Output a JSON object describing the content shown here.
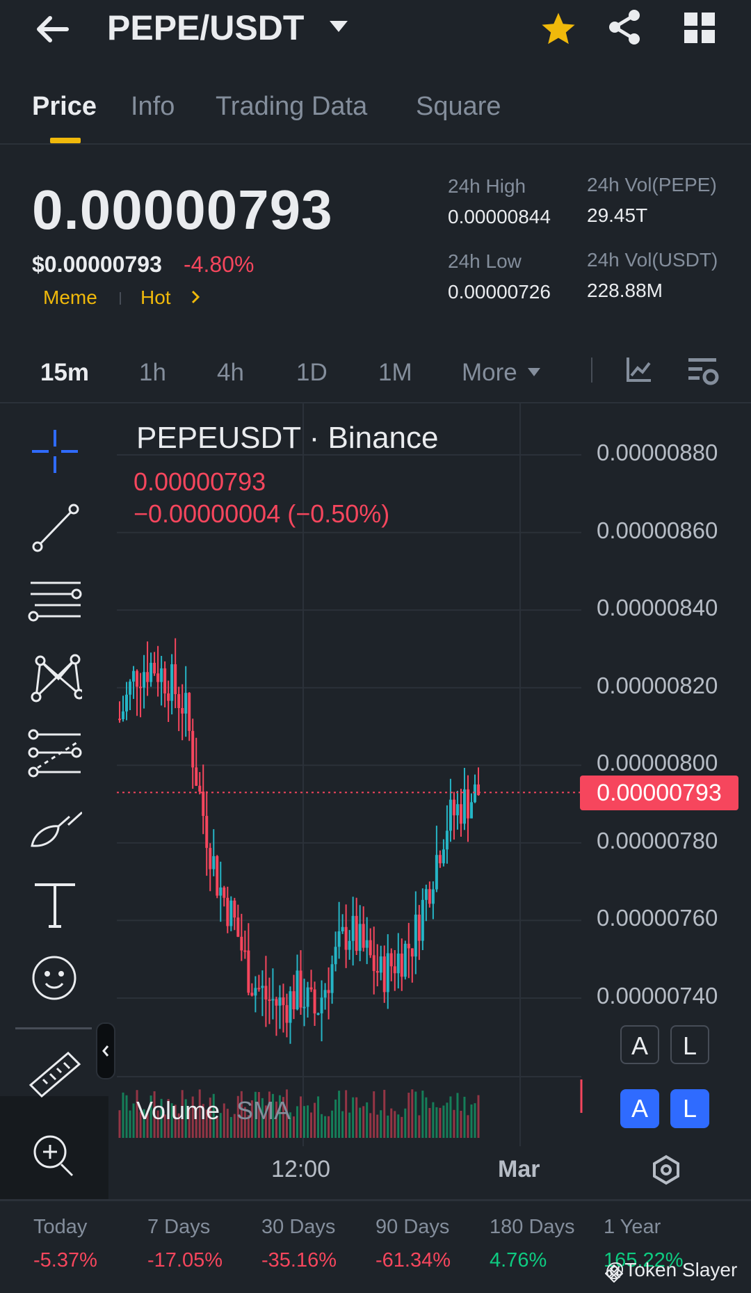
{
  "header": {
    "title": "PEPE/USDT",
    "back_icon": "arrow-left-icon",
    "favorite_icon": "star-icon",
    "share_icon": "share-icon",
    "menu_icon": "grid-icon"
  },
  "tabs": [
    {
      "label": "Price",
      "active": true
    },
    {
      "label": "Info",
      "active": false
    },
    {
      "label": "Trading Data",
      "active": false
    },
    {
      "label": "Square",
      "active": false
    }
  ],
  "price": {
    "last": "0.00000793",
    "usd": "$0.00000793",
    "change_pct": "-4.80%",
    "tags": [
      "Meme",
      "Hot"
    ]
  },
  "stats": {
    "high_label": "24h High",
    "high_value": "0.00000844",
    "low_label": "24h Low",
    "low_value": "0.00000726",
    "vol_base_label": "24h Vol(PEPE)",
    "vol_base_value": "29.45T",
    "vol_quote_label": "24h Vol(USDT)",
    "vol_quote_value": "228.88M"
  },
  "timeframes": {
    "items": [
      "15m",
      "1h",
      "4h",
      "1D",
      "1M",
      "More"
    ],
    "active": "15m"
  },
  "chart": {
    "symbol_title": "PEPEUSDT · Binance",
    "last_price": "0.00000793",
    "change_text": "−0.00000004 (−0.50%)",
    "price_badge": "0.00000793",
    "y_ticks": [
      "0.00000880",
      "0.00000860",
      "0.00000840",
      "0.00000820",
      "0.00000800",
      "0.00000780",
      "0.00000760",
      "0.00000740"
    ],
    "x_ticks": [
      "12:00",
      "Mar"
    ],
    "volume_label": "Volume",
    "volume_sma": "SMA",
    "auto_label": "A",
    "log_label": "L",
    "colors": {
      "up": "#0ecb81",
      "down": "#f6465d",
      "up_candle": "#26b5c6"
    }
  },
  "chart_data": {
    "type": "candlestick",
    "title": "PEPEUSDT · Binance",
    "interval": "15m",
    "y_range": [
      7.2e-06,
      8.9e-06
    ],
    "y_ticks": [
      8.8e-06,
      8.6e-06,
      8.4e-06,
      8.2e-06,
      8e-06,
      7.8e-06,
      7.6e-06,
      7.4e-06
    ],
    "x_ticks": [
      "12:00",
      "Mar"
    ],
    "last_price": 7.93e-06,
    "close_trend": [
      8.12e-06,
      8.24e-06,
      8.26e-06,
      8.22e-06,
      8.15e-06,
      7.9e-06,
      7.7e-06,
      7.6e-06,
      7.45e-06,
      7.4e-06,
      7.38e-06,
      7.42e-06,
      7.36e-06,
      7.48e-06,
      7.58e-06,
      7.52e-06,
      7.46e-06,
      7.5e-06,
      7.55e-06,
      7.7e-06,
      7.85e-06,
      7.9e-06,
      7.93e-06
    ]
  },
  "tools": [
    "crosshair-icon",
    "trend-line-icon",
    "horizontal-lines-icon",
    "pattern-icon",
    "fib-icon",
    "brush-icon",
    "text-icon",
    "emoji-icon",
    "ruler-icon",
    "zoom-in-icon"
  ],
  "performance": [
    {
      "label": "Today",
      "value": "-5.37%",
      "dir": "neg"
    },
    {
      "label": "7 Days",
      "value": "-17.05%",
      "dir": "neg"
    },
    {
      "label": "30 Days",
      "value": "-35.16%",
      "dir": "neg"
    },
    {
      "label": "90 Days",
      "value": "-61.34%",
      "dir": "neg"
    },
    {
      "label": "180 Days",
      "value": "4.76%",
      "dir": "pos"
    },
    {
      "label": "1 Year",
      "value": "165.22%",
      "dir": "pos"
    }
  ],
  "watermark": "@Token Slayer"
}
